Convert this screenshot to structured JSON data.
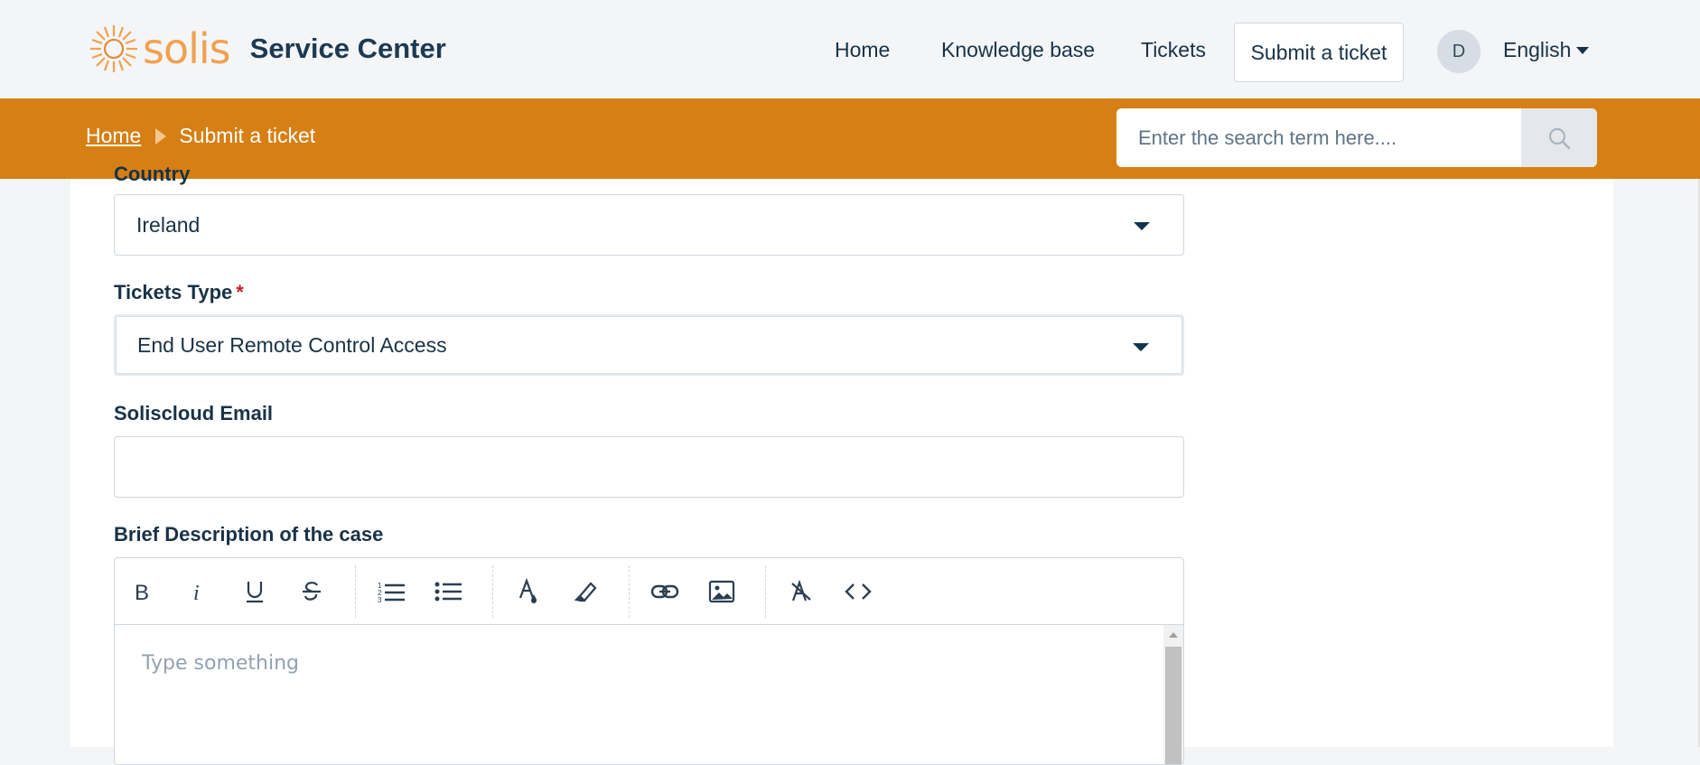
{
  "brand": {
    "logo_text": "solis",
    "title": "Service Center"
  },
  "nav": {
    "home": "Home",
    "knowledge_base": "Knowledge base",
    "tickets": "Tickets",
    "submit_ticket": "Submit a ticket",
    "avatar_initial": "D",
    "language": "English"
  },
  "breadcrumb": {
    "home": "Home",
    "current": "Submit a ticket"
  },
  "search": {
    "placeholder": "Enter the search term here...."
  },
  "form": {
    "country": {
      "label": "Country",
      "value": "Ireland"
    },
    "ticket_type": {
      "label": "Tickets Type",
      "required_mark": "*",
      "value": "End User Remote Control Access"
    },
    "soliscloud_email": {
      "label": "Soliscloud Email",
      "value": ""
    },
    "description": {
      "label": "Brief Description of the case",
      "placeholder": "Type something",
      "toolbar": [
        "bold-icon",
        "italic-icon",
        "underline-icon",
        "strikethrough-icon",
        "ordered-list-icon",
        "bullet-list-icon",
        "font-color-icon",
        "highlight-icon",
        "link-icon",
        "image-icon",
        "clear-format-icon",
        "code-icon"
      ]
    }
  },
  "colors": {
    "accent": "#d67f14",
    "brand_orange": "#f0a14f",
    "required": "#c82124"
  }
}
